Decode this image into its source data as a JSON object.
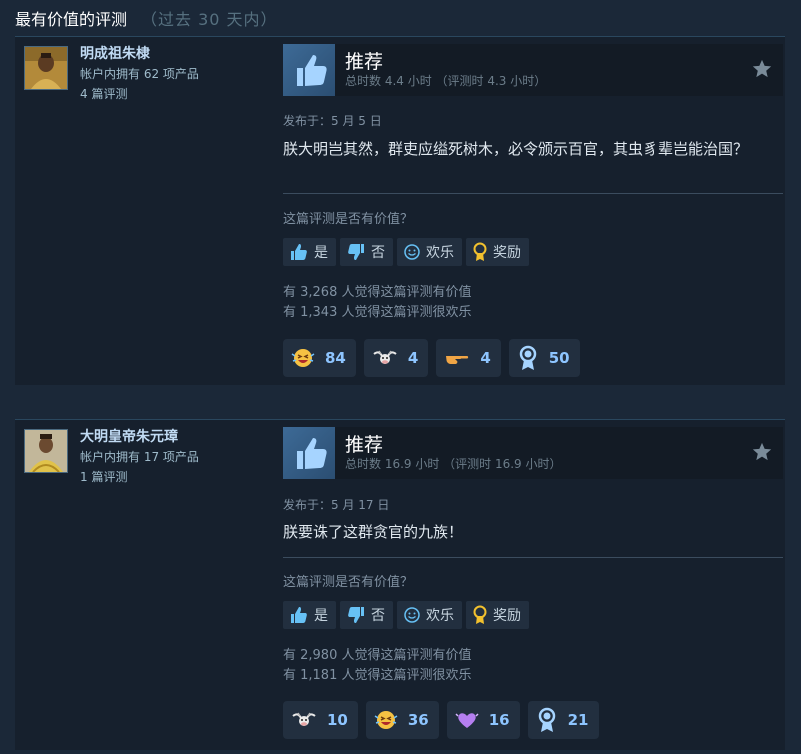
{
  "header": {
    "title": "最有价值的评测",
    "subtitle": "（过去 30 天内）"
  },
  "reviews": [
    {
      "author": "明成祖朱棣",
      "products": "帐户内拥有 62 项产品",
      "review_count": "4 篇评测",
      "verdict": "推荐",
      "hours": "总时数 4.4 小时 （评测时 4.3 小时）",
      "posted": "发布于：5 月 5 日",
      "content": "朕大明岂其然，群吏应缢死树木，必令颁示百官，其虫豸辈岂能治国？",
      "helpful_question": "这篇评测是否有价值？",
      "buttons": {
        "yes": "是",
        "no": "否",
        "funny": "欢乐",
        "award": "奖励"
      },
      "helpful_count": "有 3,268 人觉得这篇评测有价值",
      "funny_count": "有 1,343 人觉得这篇评测很欢乐",
      "awards": [
        {
          "icon": "laughing-face-icon",
          "count": "84"
        },
        {
          "icon": "winged-cow-icon",
          "count": "4"
        },
        {
          "icon": "pointing-hand-icon",
          "count": "4"
        },
        {
          "icon": "medal-icon",
          "count": "50"
        }
      ]
    },
    {
      "author": "大明皇帝朱元璋",
      "products": "帐户内拥有 17 项产品",
      "review_count": "1 篇评测",
      "verdict": "推荐",
      "hours": "总时数 16.9 小时 （评测时 16.9 小时）",
      "posted": "发布于：5 月 17 日",
      "content": "朕要诛了这群贪官的九族！",
      "helpful_question": "这篇评测是否有价值？",
      "buttons": {
        "yes": "是",
        "no": "否",
        "funny": "欢乐",
        "award": "奖励"
      },
      "helpful_count": "有 2,980 人觉得这篇评测有价值",
      "funny_count": "有 1,181 人觉得这篇评测很欢乐",
      "awards": [
        {
          "icon": "winged-cow-icon",
          "count": "10"
        },
        {
          "icon": "laughing-face-icon",
          "count": "36"
        },
        {
          "icon": "purple-heart-icon",
          "count": "16"
        },
        {
          "icon": "medal-icon",
          "count": "21"
        }
      ]
    }
  ],
  "colors": {
    "background": "#1b2838",
    "panel": "#16202d",
    "accent": "#8ec5ff",
    "thumb": "#3d6a96"
  }
}
